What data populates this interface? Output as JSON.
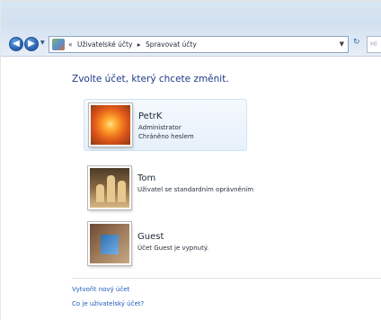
{
  "address_bar": {
    "breadcrumbs": [
      "«",
      "Uživatelské účty",
      "▸",
      "Spravovat účty"
    ],
    "search_placeholder": "Hl"
  },
  "main": {
    "heading": "Zvolte účet, který chcete změnit.",
    "accounts": [
      {
        "name": "PetrK",
        "line1": "Administrator",
        "line2": "Chráněno heslem",
        "picture": "flower"
      },
      {
        "name": "Tom",
        "line1": "Uživatel se standardním oprávněním",
        "line2": "",
        "picture": "chess"
      },
      {
        "name": "Guest",
        "line1": "Účet Guest je vypnutý.",
        "line2": "",
        "picture": "guest-briefcase"
      }
    ],
    "links": {
      "create_account": "Vytvořit nový účet",
      "what_is_account": "Co je uživatelský účet?"
    }
  },
  "icons": {
    "back": "back-arrow-icon",
    "forward": "forward-arrow-icon",
    "refresh": "refresh-icon",
    "control_panel": "control-panel-icon"
  },
  "colors": {
    "heading": "#1e3b87",
    "link": "#1e5ab8",
    "selection": "#e7f1fb"
  }
}
